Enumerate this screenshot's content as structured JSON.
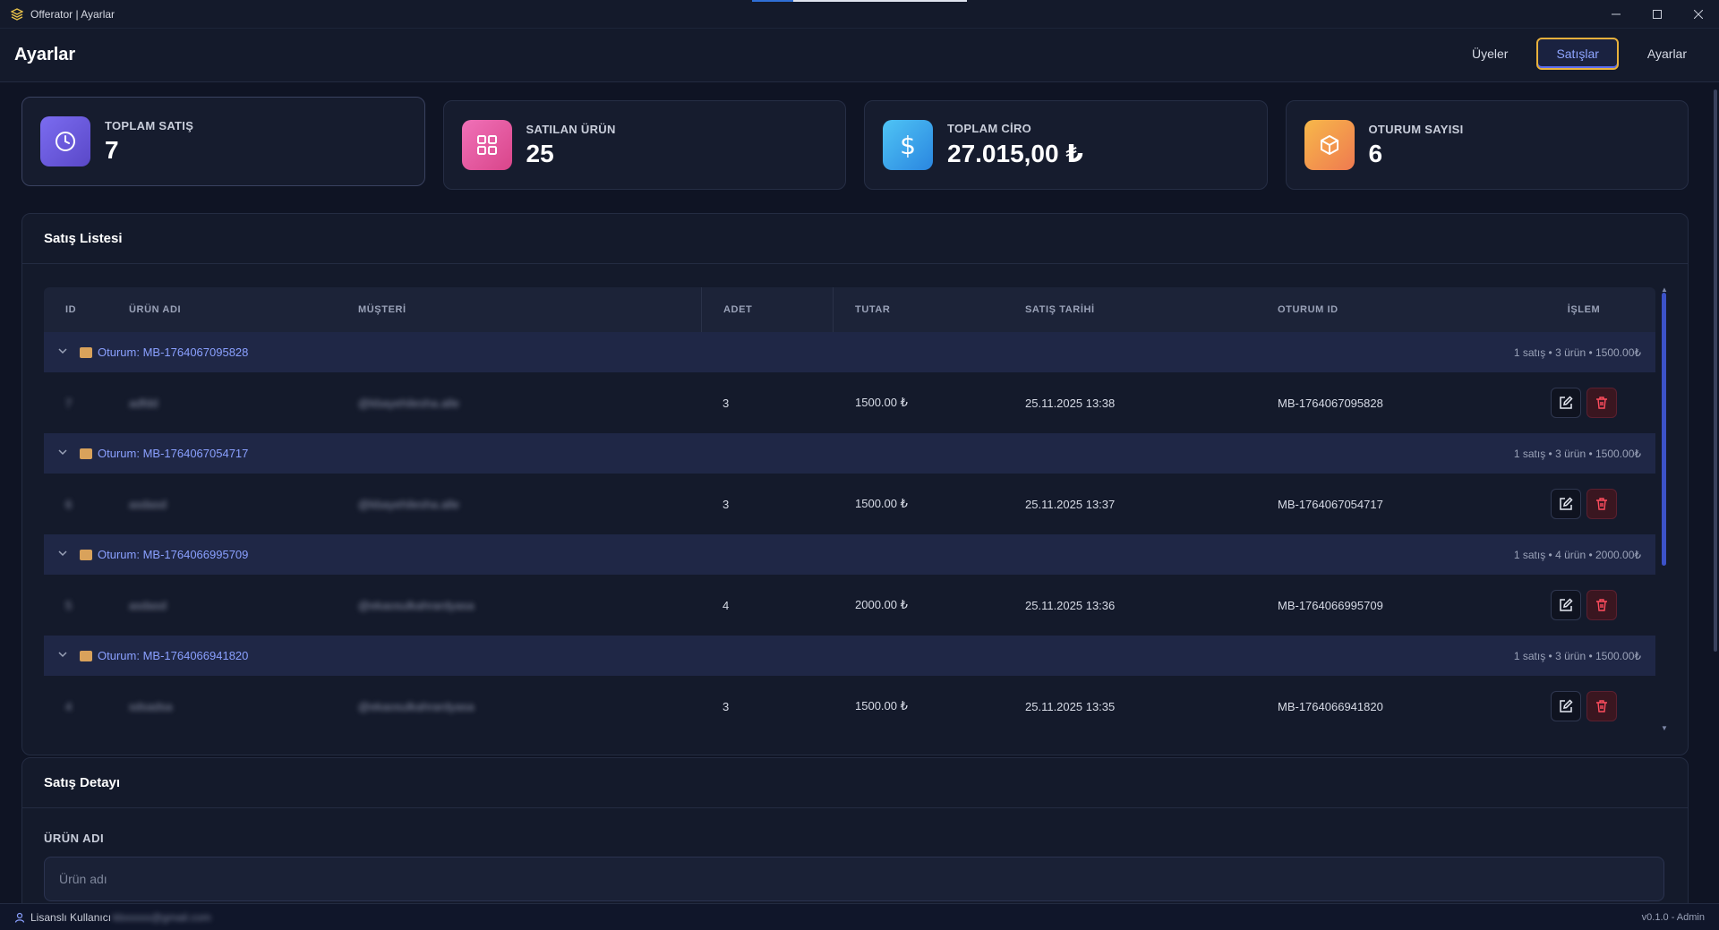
{
  "window": {
    "title": "Offerator | Ayarlar",
    "minimize_icon": "minimize-icon",
    "maximize_icon": "maximize-icon",
    "close_icon": "close-icon"
  },
  "header": {
    "title": "Ayarlar",
    "nav": [
      "Üyeler",
      "Satışlar",
      "Ayarlar"
    ],
    "active_nav": "Satışlar"
  },
  "stats": [
    {
      "label": "TOPLAM SATIŞ",
      "value": "7",
      "icon": "clock-icon",
      "color": "#6a5be0"
    },
    {
      "label": "SATILAN ÜRÜN",
      "value": "25",
      "icon": "grid-icon",
      "color": "#e9549a"
    },
    {
      "label": "TOPLAM CİRO",
      "value": "27.015,00 ₺",
      "icon": "dollar-icon",
      "color": "#2f9be8"
    },
    {
      "label": "OTURUM SAYISI",
      "value": "6",
      "icon": "box-icon",
      "color": "#f19a3e"
    }
  ],
  "sales_list": {
    "title": "Satış Listesi",
    "columns": [
      "ID",
      "ÜRÜN ADI",
      "MÜŞTERİ",
      "ADET",
      "TUTAR",
      "SATIŞ TARİHİ",
      "OTURUM ID",
      "İŞLEM"
    ],
    "groups": [
      {
        "title": "Oturum: MB-1764067095828",
        "summary": "1 satış • 3 ürün • 1500.00₺",
        "row": {
          "id": "7",
          "product": "adfdd",
          "customer": "@kbayehilesha.alle",
          "qty": "3",
          "amount": "1500.00 ₺",
          "date": "25.11.2025 13:38",
          "session": "MB-1764067095828"
        }
      },
      {
        "title": "Oturum: MB-1764067054717",
        "summary": "1 satış • 3 ürün • 1500.00₺",
        "row": {
          "id": "6",
          "product": "asdasd",
          "customer": "@kbayehilesha.alle",
          "qty": "3",
          "amount": "1500.00 ₺",
          "date": "25.11.2025 13:37",
          "session": "MB-1764067054717"
        }
      },
      {
        "title": "Oturum: MB-1764066995709",
        "summary": "1 satış • 4 ürün • 2000.00₺",
        "row": {
          "id": "5",
          "product": "asdasd",
          "customer": "@ekaosulkahrardyasa",
          "qty": "4",
          "amount": "2000.00 ₺",
          "date": "25.11.2025 13:36",
          "session": "MB-1764066995709"
        }
      },
      {
        "title": "Oturum: MB-1764066941820",
        "summary": "1 satış • 3 ürün • 1500.00₺",
        "row": {
          "id": "4",
          "product": "sdsadsa",
          "customer": "@ekaosulkahrardyasa",
          "qty": "3",
          "amount": "1500.00 ₺",
          "date": "25.11.2025 13:35",
          "session": "MB-1764066941820"
        }
      }
    ]
  },
  "sale_detail": {
    "title": "Satış Detayı",
    "field_label": "ÜRÜN ADI",
    "field_placeholder": "Ürün adı"
  },
  "statusbar": {
    "license_label": "Lisanslı Kullanıcı",
    "email": "kbxxxxx@gmail.com",
    "version": "v0.1.0 - Admin"
  }
}
